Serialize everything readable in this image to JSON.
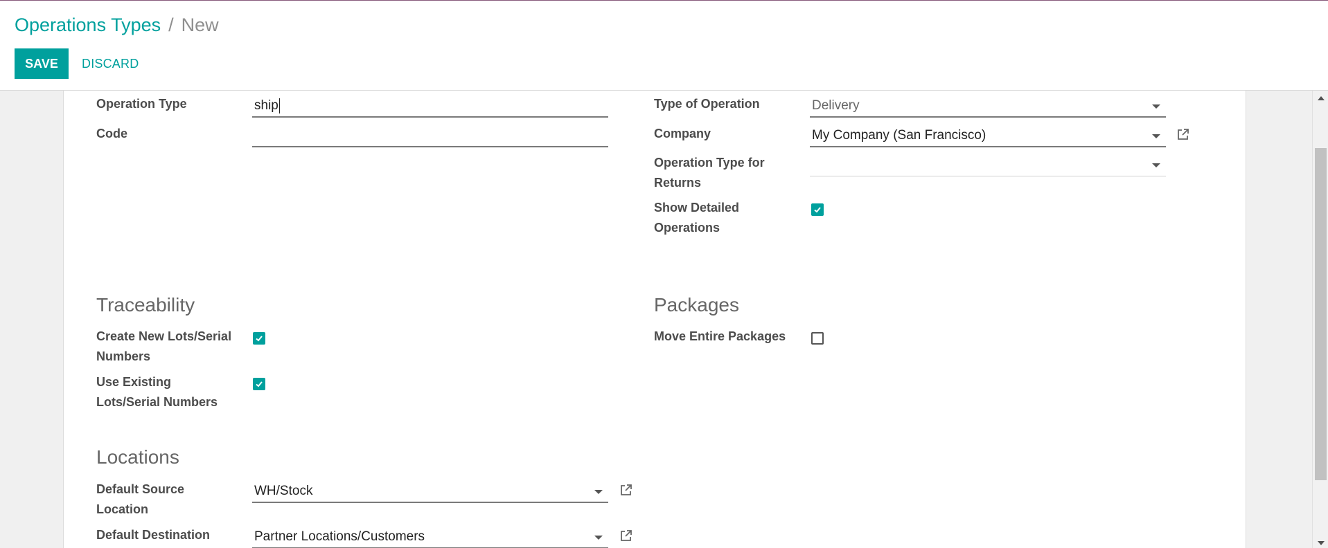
{
  "breadcrumb": {
    "parent": "Operations Types",
    "separator": "/",
    "current": "New"
  },
  "toolbar": {
    "save_label": "SAVE",
    "discard_label": "DISCARD"
  },
  "form": {
    "left": {
      "operation_type_label": "Operation Type",
      "operation_type_value": "ship",
      "code_label": "Code",
      "code_value": ""
    },
    "right": {
      "type_of_operation_label": "Type of Operation",
      "type_of_operation_value": "Delivery",
      "company_label": "Company",
      "company_value": "My Company (San Francisco)",
      "return_type_label_line1": "Operation Type for",
      "return_type_label_line2": "Returns",
      "return_type_value": "",
      "show_detailed_label_line1": "Show Detailed",
      "show_detailed_label_line2": "Operations",
      "show_detailed_checked": true
    },
    "traceability": {
      "title": "Traceability",
      "create_lots_label_line1": "Create New Lots/Serial",
      "create_lots_label_line2": "Numbers",
      "create_lots_checked": true,
      "use_existing_label_line1": "Use Existing",
      "use_existing_label_line2": "Lots/Serial Numbers",
      "use_existing_checked": true
    },
    "packages": {
      "title": "Packages",
      "move_entire_label": "Move Entire Packages",
      "move_entire_checked": false
    },
    "locations": {
      "title": "Locations",
      "default_source_label_line1": "Default Source",
      "default_source_label_line2": "Location",
      "default_source_value": "WH/Stock",
      "default_dest_label_line1": "Default Destination",
      "default_dest_value": "Partner Locations/Customers"
    }
  },
  "colors": {
    "accent": "#00A09D",
    "text": "#4c4c4c",
    "muted": "#8f8f8f",
    "top_border": "#875a7b"
  },
  "icons": {
    "external_link": "external-link-icon",
    "dropdown": "caret-down-icon",
    "check": "check-icon"
  }
}
